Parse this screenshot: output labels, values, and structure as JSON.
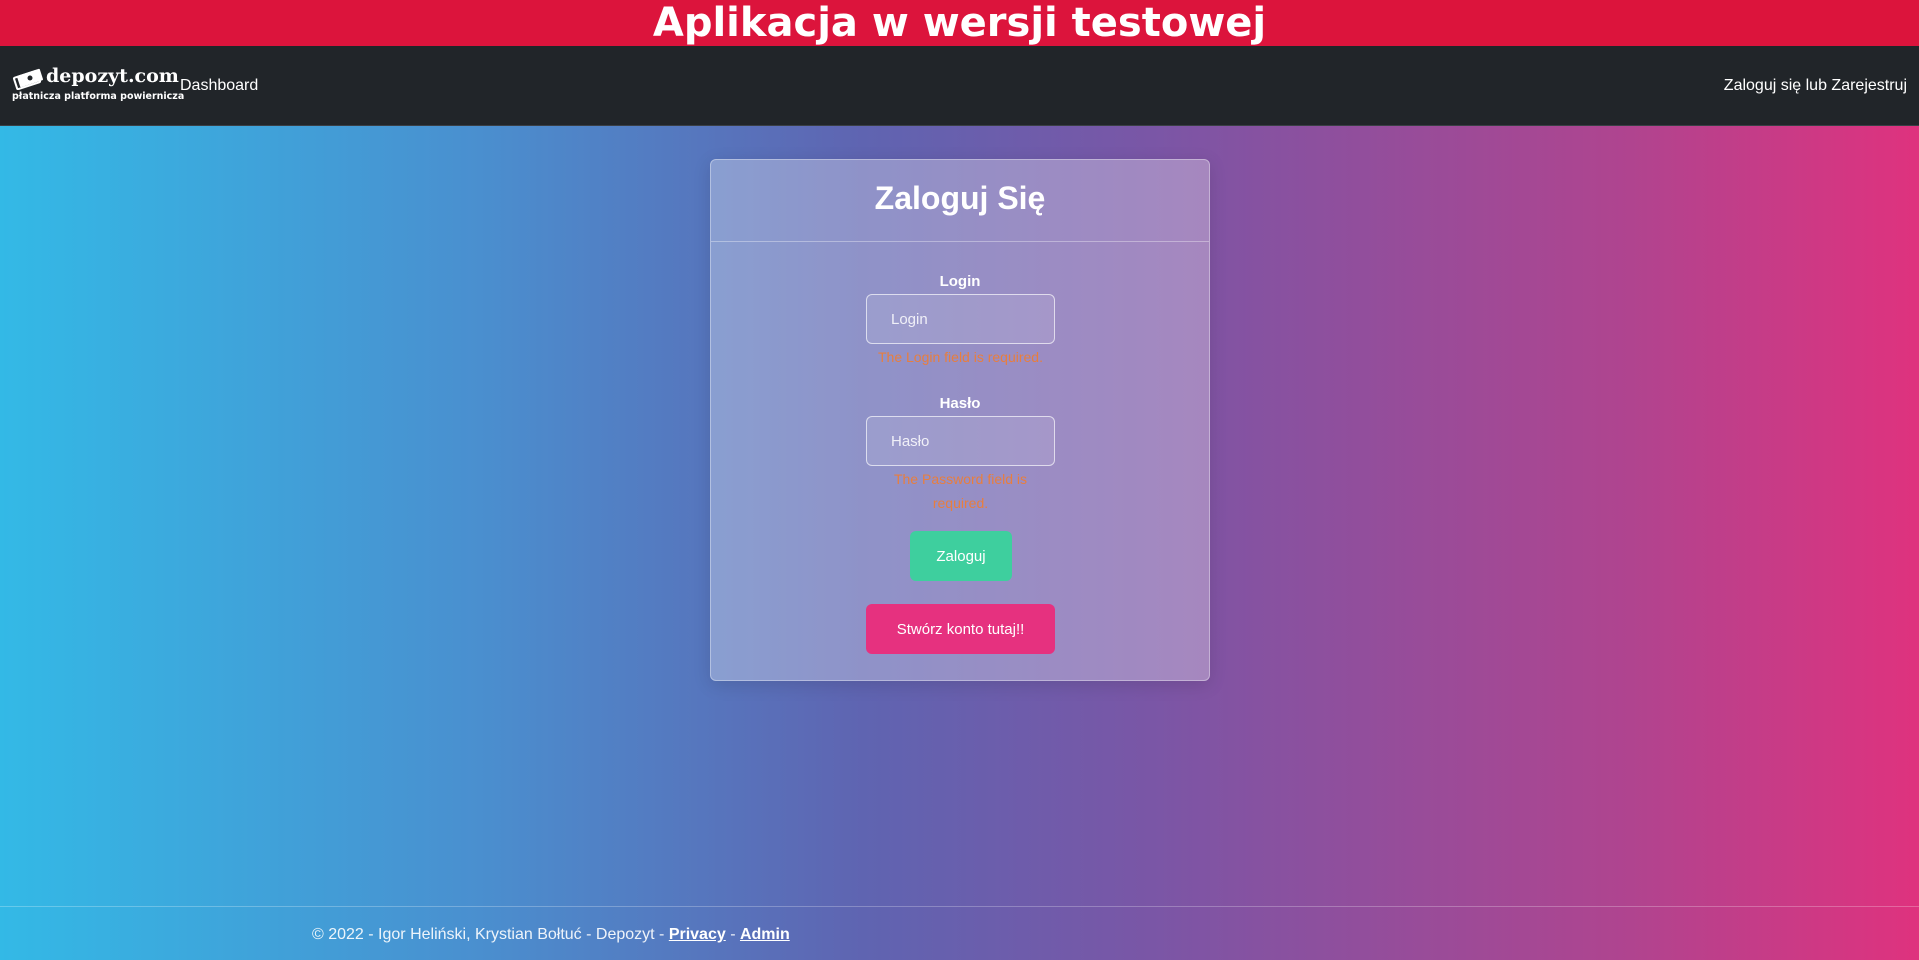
{
  "banner": {
    "text": "Aplikacja w wersji testowej"
  },
  "navbar": {
    "brand_name": "depozyt.com",
    "brand_tagline": "płatnicza platforma powiernicza",
    "dashboard_label": "Dashboard",
    "auth_label": "Zaloguj się lub Zarejestruj"
  },
  "login_card": {
    "title": "Zaloguj Się",
    "login": {
      "label": "Login",
      "placeholder": "Login",
      "value": "",
      "error": "The Login field is required."
    },
    "password": {
      "label": "Hasło",
      "placeholder": "Hasło",
      "value": "",
      "error": "The Password field is required."
    },
    "submit_label": "Zaloguj",
    "register_label": "Stwórz konto tutaj!!"
  },
  "footer": {
    "copyright": "© 2022 - Igor Heliński, Krystian Bołtuć - Depozyt - ",
    "separator": " - ",
    "privacy_label": "Privacy",
    "admin_label": "Admin"
  },
  "colors": {
    "banner": "#dc143c",
    "navbar": "#212529",
    "error": "#e87e3e",
    "login_button": "#3ecf9e",
    "register_button": "#e6317f"
  },
  "icons": {
    "brand": "banknotes-icon"
  }
}
